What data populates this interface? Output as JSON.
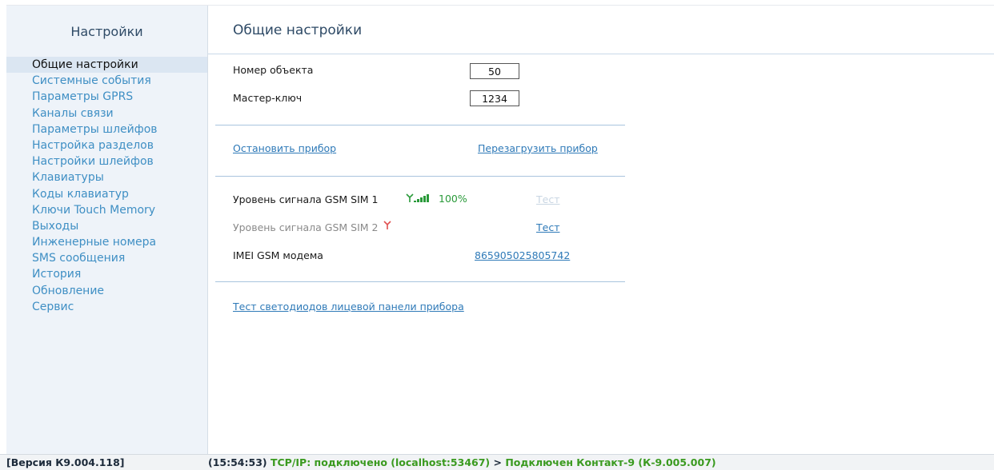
{
  "sidebar": {
    "title": "Настройки",
    "items": [
      {
        "label": "Общие настройки",
        "active": true
      },
      {
        "label": "Системные события"
      },
      {
        "label": "Параметры GPRS"
      },
      {
        "label": "Каналы связи"
      },
      {
        "label": "Параметры шлейфов"
      },
      {
        "label": "Настройка разделов"
      },
      {
        "label": "Настройки шлейфов"
      },
      {
        "label": "Клавиатуры"
      },
      {
        "label": "Коды клавиатур"
      },
      {
        "label": "Ключи Touch Memory"
      },
      {
        "label": "Выходы"
      },
      {
        "label": "Инженерные номера"
      },
      {
        "label": "SMS сообщения"
      },
      {
        "label": "История"
      },
      {
        "label": "Обновление"
      },
      {
        "label": "Сервис"
      }
    ]
  },
  "main": {
    "title": "Общие настройки",
    "object_number": {
      "label": "Номер объекта",
      "value": "50"
    },
    "master_key": {
      "label": "Мастер-ключ",
      "value": "1234"
    },
    "actions": {
      "stop": "Остановить прибор",
      "reboot": "Перезагрузить прибор"
    },
    "gsm1": {
      "label": "Уровень сигнала GSM SIM 1",
      "percent": "100%",
      "test": "Тест",
      "icon": "signal-bars-icon"
    },
    "gsm2": {
      "label": "Уровень сигнала GSM SIM 2",
      "test": "Тест",
      "icon": "antenna-icon"
    },
    "imei": {
      "label": "IMEI GSM модема",
      "value": "865905025805742"
    },
    "led_test": "Тест светодиодов лицевой панели прибора"
  },
  "status_bar": {
    "version": "[Версия К9.004.118]",
    "time": "(15:54:53)",
    "tcp": "TCP/IP: подключено (localhost:53467)",
    "arrow": ">",
    "device": "Подключен Контакт-9 (К-9.005.007)"
  },
  "colors": {
    "link": "#2f7ab8",
    "status_green": "#3a9a1f",
    "signal_green": "#2a9a3a",
    "signal_red": "#e05050"
  }
}
